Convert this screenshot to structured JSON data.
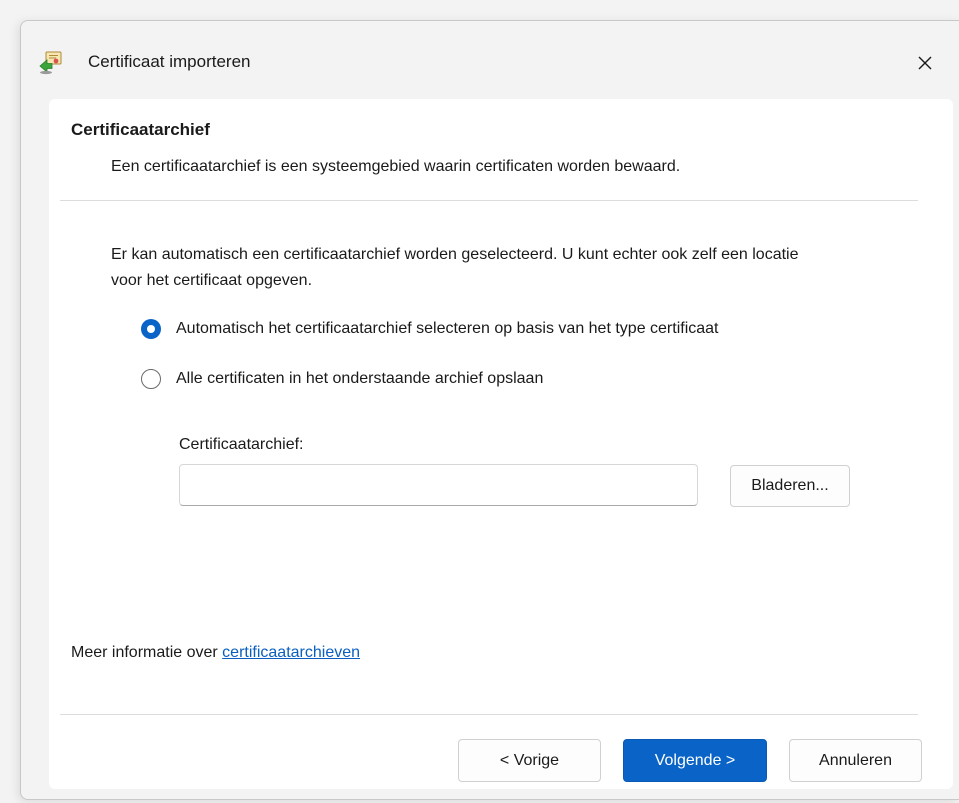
{
  "window": {
    "title": "Certificaat importeren"
  },
  "page": {
    "section_title": "Certificaatarchief",
    "section_description": "Een certificaatarchief is een systeemgebied waarin certificaten worden bewaard.",
    "intro": "Er kan automatisch een certificaatarchief worden geselecteerd. U kunt echter ook zelf een locatie voor het certificaat opgeven.",
    "options": [
      {
        "label": "Automatisch het certificaatarchief selecteren op basis van het type certificaat",
        "selected": true
      },
      {
        "label": "Alle certificaten in het onderstaande archief opslaan",
        "selected": false
      }
    ],
    "store_field": {
      "label": "Certificaatarchief:",
      "value": "",
      "browse_label": "Bladeren..."
    },
    "more_info": {
      "prefix": "Meer informatie over ",
      "link": "certificaatarchieven"
    }
  },
  "footer": {
    "back_label": "< Vorige",
    "next_label": "Volgende >",
    "cancel_label": "Annuleren"
  },
  "icons": {
    "app": "certificate-import-icon",
    "close": "close-icon"
  },
  "colors": {
    "accent": "#0a63c7",
    "link": "#0a5fbf"
  }
}
